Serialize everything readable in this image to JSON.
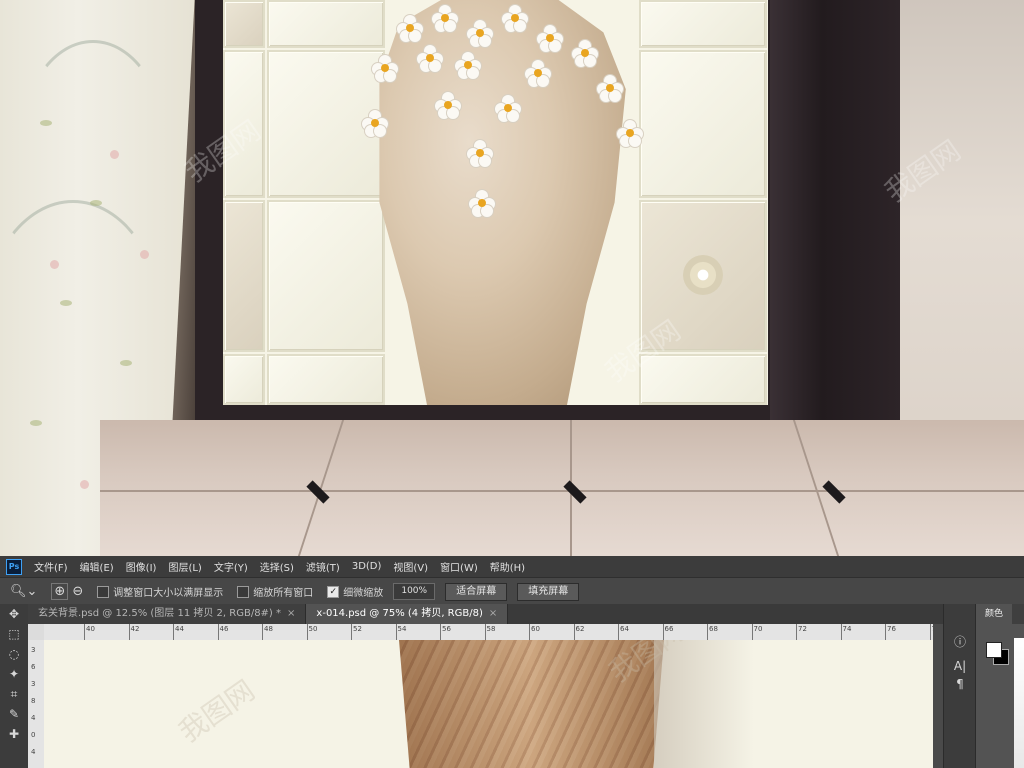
{
  "menubar": {
    "logo": "Ps",
    "items": [
      "文件(F)",
      "编辑(E)",
      "图像(I)",
      "图层(L)",
      "文字(Y)",
      "选择(S)",
      "滤镜(T)",
      "3D(D)",
      "视图(V)",
      "窗口(W)",
      "帮助(H)"
    ]
  },
  "options": {
    "resize_windows_label": "调整窗口大小以满屏显示",
    "zoom_all_label": "缩放所有窗口",
    "scrubby_zoom_label": "细微缩放",
    "zoom_value": "100%",
    "fit_screen_label": "适合屏幕",
    "fill_screen_label": "填充屏幕"
  },
  "tabs": [
    {
      "label": "玄关背景.psd @ 12.5% (图层 11 拷贝 2, RGB/8#) *",
      "close": "×"
    },
    {
      "label": "x-014.psd @ 75% (4 拷贝, RGB/8)",
      "close": "×"
    }
  ],
  "ruler_h": [
    "40",
    "42",
    "44",
    "46",
    "48",
    "50",
    "52",
    "54",
    "56",
    "58",
    "60",
    "62",
    "64",
    "66",
    "68",
    "70",
    "72",
    "74",
    "76",
    "78"
  ],
  "ruler_v": [
    "3",
    "6",
    "3",
    "8",
    "4",
    "0",
    "4"
  ],
  "panel": {
    "color_tab": "颜色",
    "fg_color": "#ffffff",
    "bg_color": "#000000"
  },
  "icons": {
    "toolbar": [
      "move-icon",
      "marquee-icon",
      "lasso-icon",
      "magic-wand-icon",
      "crop-icon",
      "eyedropper-icon",
      "healing-brush-icon"
    ],
    "side": [
      "info-icon",
      "character-icon",
      "paragraph-icon"
    ]
  },
  "watermark": "我图网"
}
